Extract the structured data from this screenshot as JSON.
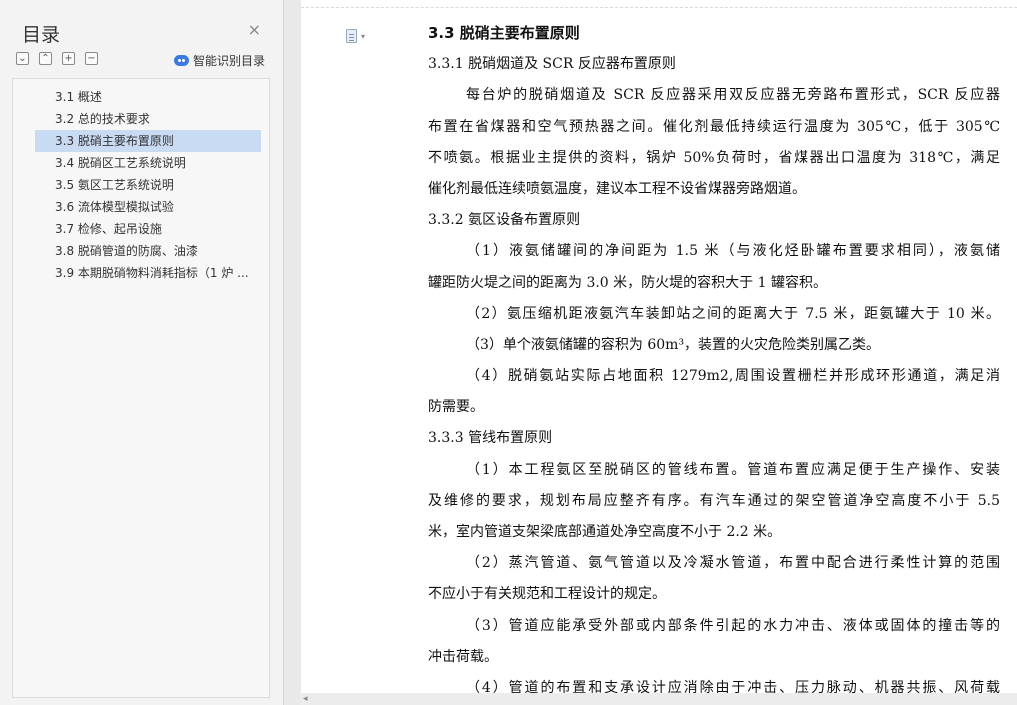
{
  "toc": {
    "title": "目录",
    "close_glyph": "×",
    "tools": [
      {
        "name": "expand-all",
        "glyph": "⌄"
      },
      {
        "name": "collapse-all",
        "glyph": "⌃"
      },
      {
        "name": "add-heading",
        "glyph": "+"
      },
      {
        "name": "remove-heading",
        "glyph": "−"
      }
    ],
    "smart_label": "智能识别目录",
    "items": [
      "3.1  概述",
      "3.2  总的技术要求",
      "3.3  脱硝主要布置原则",
      "3.4 脱硝区工艺系统说明",
      "3.5  氨区工艺系统说明",
      "3.6  流体模型模拟试验",
      "3.7 检修、起吊设施",
      "3.8 脱硝管道的防腐、油漆",
      "3.9  本期脱硝物料消耗指标（1 炉 ..."
    ],
    "active_index": 2
  },
  "doc": {
    "heading": "3.3 脱硝主要布置原则",
    "lines": [
      {
        "type": "h4",
        "text": "3.3.1 脱硝烟道及 SCR 反应器布置原则"
      },
      {
        "type": "p-first",
        "text": "每台炉的脱硝烟道及 SCR 反应器采用双反应器无旁路布置形式，SCR 反应器"
      },
      {
        "type": "p",
        "text": "布置在省煤器和空气预热器之间。催化剂最低持续运行温度为 305℃，低于 305℃"
      },
      {
        "type": "p",
        "text": "不喷氨。根据业主提供的资料，锅炉 50%负荷时，省煤器出口温度为 318℃，满足"
      },
      {
        "type": "p-last",
        "text": "催化剂最低连续喷氨温度，建议本工程不设省煤器旁路烟道。"
      },
      {
        "type": "h4",
        "text": "3.3.2 氨区设备布置原则"
      },
      {
        "type": "p-first",
        "text": "（1）液氨储罐间的净间距为 1.5 米（与液化烃卧罐布置要求相同），液氨储"
      },
      {
        "type": "p-last",
        "text": "罐距防火堤之间的距离为 3.0 米，防火堤的容积大于 1 罐容积。"
      },
      {
        "type": "p-first",
        "text": "（2）氨压缩机距液氨汽车装卸站之间的距离大于 7.5 米，距氨罐大于 10 米。"
      },
      {
        "type": "p-first-last",
        "text": "（3）单个液氨储罐的容积为 60m³，装置的火灾危险类别属乙类。"
      },
      {
        "type": "p-first",
        "text": "（4）脱硝氨站实际占地面积 1279m2,周围设置栅栏并形成环形通道，满足消"
      },
      {
        "type": "p-last",
        "text": "防需要。"
      },
      {
        "type": "h4",
        "text": "3.3.3 管线布置原则"
      },
      {
        "type": "p-first",
        "text": "（1）本工程氨区至脱硝区的管线布置。管道布置应满足便于生产操作、安装"
      },
      {
        "type": "p",
        "text": "及维修的要求，规划布局应整齐有序。有汽车通过的架空管道净空高度不小于 5.5"
      },
      {
        "type": "p-last",
        "text": "米，室内管道支架梁底部通道处净空高度不小于 2.2 米。"
      },
      {
        "type": "p-first",
        "text": "（2）蒸汽管道、氨气管道以及冷凝水管道，布置中配合进行柔性计算的范围"
      },
      {
        "type": "p-last",
        "text": "不应小于有关规范和工程设计的规定。"
      },
      {
        "type": "p-first",
        "text": "（3）管道应能承受外部或内部条件引起的水力冲击、液体或固体的撞击等的"
      },
      {
        "type": "p-last",
        "text": "冲击荷载。"
      },
      {
        "type": "p-first",
        "text": "（4）管道的布置和支承设计应消除由于冲击、压力脉动、机器共振、风荷载"
      }
    ]
  }
}
